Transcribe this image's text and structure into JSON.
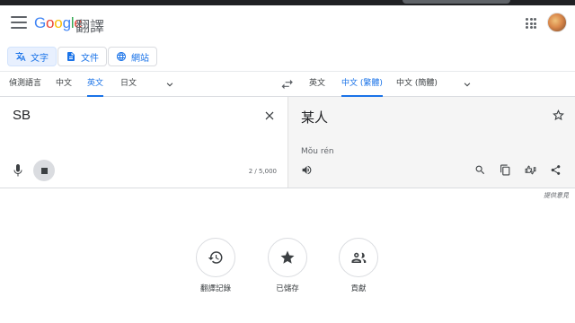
{
  "header": {
    "logo_letters": [
      {
        "ch": "G",
        "color": "#4285F4"
      },
      {
        "ch": "o",
        "color": "#EA4335"
      },
      {
        "ch": "o",
        "color": "#FBBC05"
      },
      {
        "ch": "g",
        "color": "#4285F4"
      },
      {
        "ch": "l",
        "color": "#34A853"
      },
      {
        "ch": "e",
        "color": "#EA4335"
      }
    ],
    "product": "翻譯"
  },
  "modes": [
    {
      "label": "文字",
      "icon": "translate-icon",
      "active": true
    },
    {
      "label": "文件",
      "icon": "document-icon",
      "active": false
    },
    {
      "label": "網站",
      "icon": "globe-icon",
      "active": false
    }
  ],
  "source_langs": [
    "偵測語言",
    "中文",
    "英文",
    "日文"
  ],
  "target_langs": [
    "英文",
    "中文 (繁體)",
    "中文 (簡體)"
  ],
  "source": {
    "text": "SB",
    "count": "2 / 5,000"
  },
  "target": {
    "text": "某人",
    "transliteration": "Mǒu rén"
  },
  "feedback": "提供意見",
  "quick_actions": [
    {
      "label": "翻譯記錄",
      "icon": "history-icon"
    },
    {
      "label": "已儲存",
      "icon": "star-icon"
    },
    {
      "label": "貢獻",
      "icon": "contribute-icon"
    }
  ],
  "colors": {
    "accent": "#1a73e8",
    "target_bg": "#f5f5f5"
  }
}
